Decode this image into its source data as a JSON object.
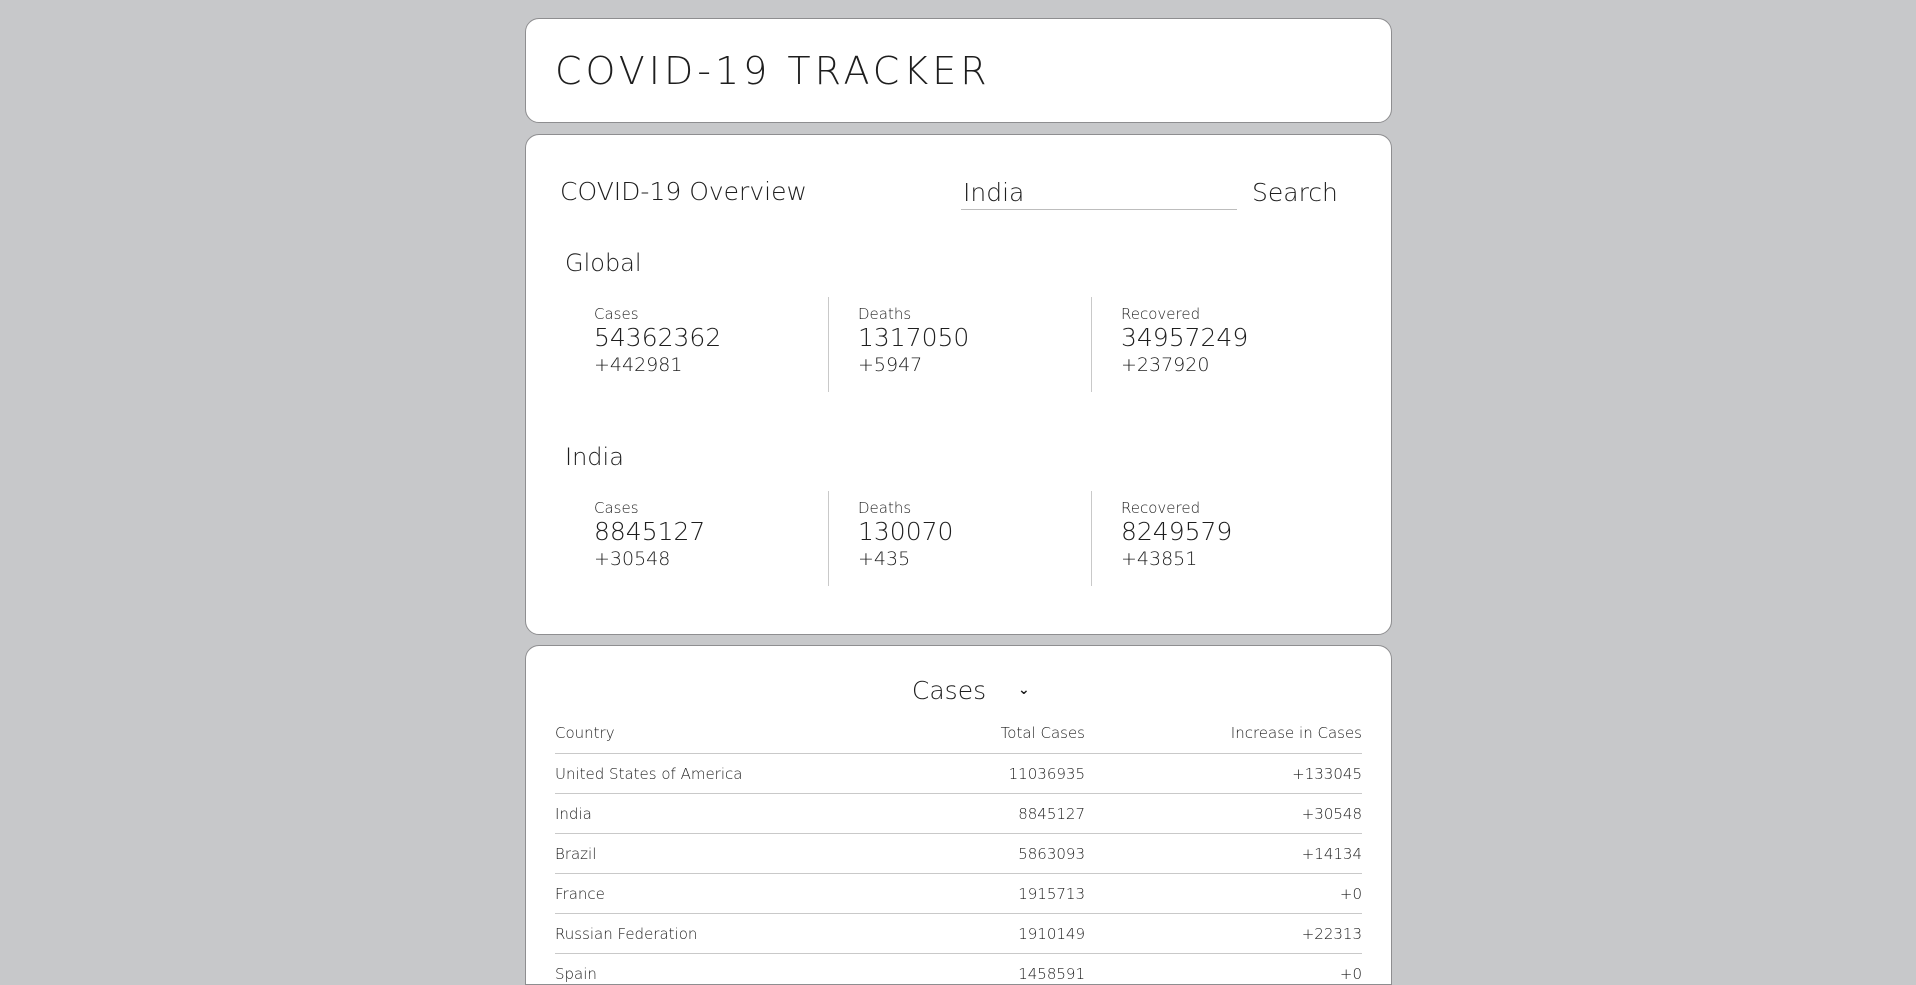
{
  "header": {
    "title": "COVID-19 TRACKER"
  },
  "overview": {
    "title": "COVID-19 Overview",
    "search": {
      "value": "India",
      "button_label": "Search"
    },
    "global": {
      "title": "Global",
      "stats": [
        {
          "label": "Cases",
          "total": "54362362",
          "delta": "+442981"
        },
        {
          "label": "Deaths",
          "total": "1317050",
          "delta": "+5947"
        },
        {
          "label": "Recovered",
          "total": "34957249",
          "delta": "+237920"
        }
      ]
    },
    "country": {
      "title": "India",
      "stats": [
        {
          "label": "Cases",
          "total": "8845127",
          "delta": "+30548"
        },
        {
          "label": "Deaths",
          "total": "130070",
          "delta": "+435"
        },
        {
          "label": "Recovered",
          "total": "8249579",
          "delta": "+43851"
        }
      ]
    }
  },
  "table": {
    "selected_metric": "Cases",
    "columns": [
      "Country",
      "Total Cases",
      "Increase in Cases"
    ],
    "rows": [
      [
        "United States of America",
        "11036935",
        "+133045"
      ],
      [
        "India",
        "8845127",
        "+30548"
      ],
      [
        "Brazil",
        "5863093",
        "+14134"
      ],
      [
        "France",
        "1915713",
        "+0"
      ],
      [
        "Russian Federation",
        "1910149",
        "+22313"
      ],
      [
        "Spain",
        "1458591",
        "+0"
      ]
    ]
  }
}
